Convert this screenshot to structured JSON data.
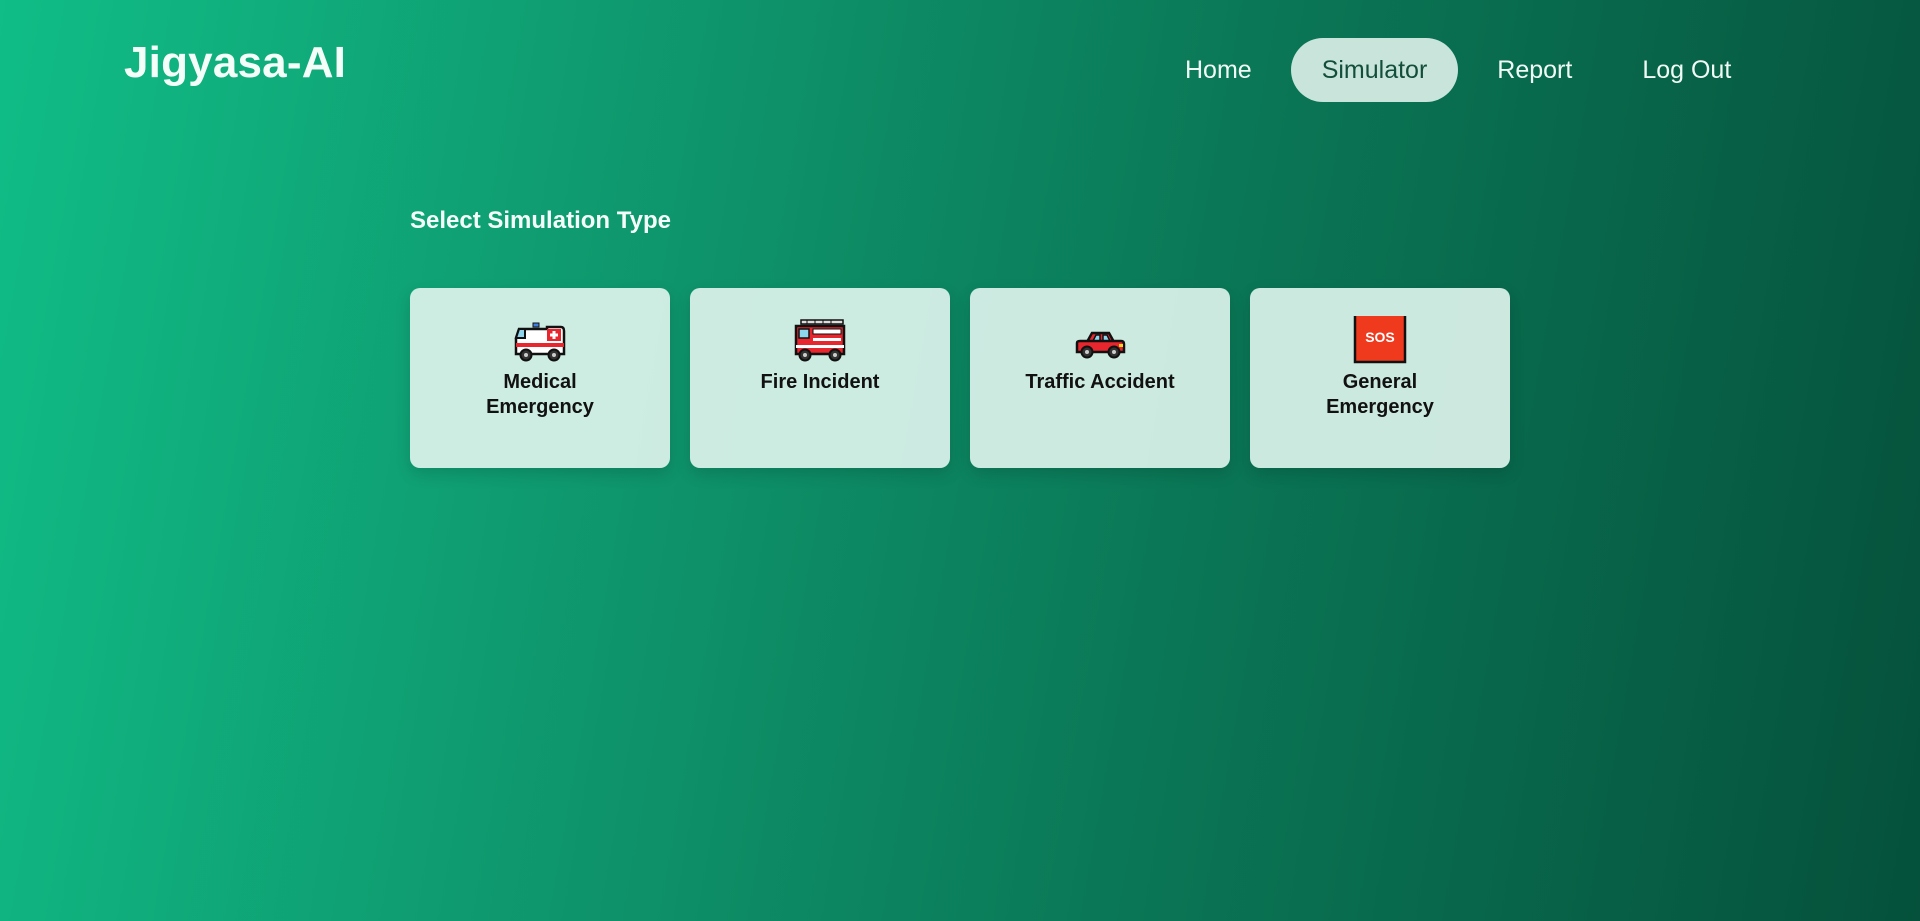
{
  "app": {
    "title": "Jigyasa-AI"
  },
  "nav": {
    "items": [
      {
        "label": "Home",
        "active": false
      },
      {
        "label": "Simulator",
        "active": true
      },
      {
        "label": "Report",
        "active": false
      },
      {
        "label": "Log Out",
        "active": false
      }
    ]
  },
  "main": {
    "section_title": "Select Simulation Type",
    "cards": [
      {
        "label": "Medical Emergency",
        "icon": "ambulance-icon"
      },
      {
        "label": "Fire Incident",
        "icon": "fire-engine-icon"
      },
      {
        "label": "Traffic Accident",
        "icon": "car-icon"
      },
      {
        "label": "General Emergency",
        "icon": "sos-icon",
        "icon_text": "SOS"
      }
    ]
  },
  "colors": {
    "background_start": "#10bd86",
    "background_end": "#05513b",
    "nav_active_bg": "#c9e4db",
    "card_bg": "#dcf2eb",
    "sos_red": "#f03a1e"
  }
}
